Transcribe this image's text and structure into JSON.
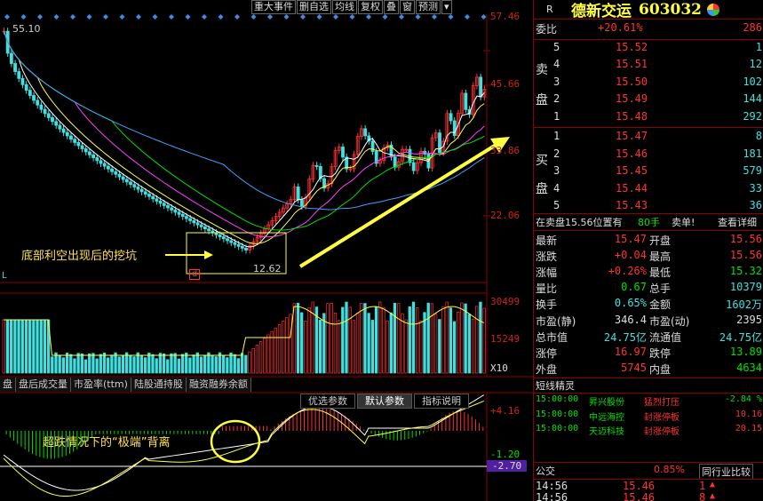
{
  "toolbar": [
    "重大事件",
    "删自选",
    "均线",
    "复权",
    "叠",
    "窗",
    "预测"
  ],
  "price_axis": {
    "p1": "57.46",
    "p2": "45.66",
    "p3": "33.86",
    "p4": "22.06"
  },
  "vol_axis": {
    "v1": "30499",
    "v2": "15249",
    "unit": "X10"
  },
  "ind_axis": {
    "a1": "+4.16",
    "a2": "-1.20",
    "a3": "-2.70"
  },
  "high_marker": "55.10",
  "low_marker": "12.62",
  "corner_l": "L",
  "tabs": [
    "盘",
    "盘后成交量",
    "市盈率(ttm)",
    "陆股通持股",
    "融资融券余额"
  ],
  "param_tabs": [
    "优选参数",
    "默认参数",
    "指标说明"
  ],
  "annotations": {
    "pit": "底部利空出现后的挖坑",
    "divergence": "超跌情况下的“极端”背离"
  },
  "badge": "d",
  "stock": {
    "r": "R",
    "name": "德新交运",
    "code": "603032"
  },
  "wei": {
    "label": "委比",
    "pct": "+20.61%",
    "diff": "286"
  },
  "sell_label": [
    "卖",
    "盘"
  ],
  "buy_label": [
    "买",
    "盘"
  ],
  "sells": [
    {
      "lvl": "5",
      "price": "15.52",
      "vol": "1"
    },
    {
      "lvl": "4",
      "price": "15.51",
      "vol": "12"
    },
    {
      "lvl": "3",
      "price": "15.50",
      "vol": "102"
    },
    {
      "lvl": "2",
      "price": "15.49",
      "vol": "144"
    },
    {
      "lvl": "1",
      "price": "15.48",
      "vol": "292"
    }
  ],
  "buys": [
    {
      "lvl": "1",
      "price": "15.47",
      "vol": "8"
    },
    {
      "lvl": "2",
      "price": "15.46",
      "vol": "181"
    },
    {
      "lvl": "3",
      "price": "15.45",
      "vol": "579"
    },
    {
      "lvl": "4",
      "price": "15.44",
      "vol": "33"
    },
    {
      "lvl": "5",
      "price": "15.43",
      "vol": "36"
    }
  ],
  "inline_bar": {
    "text": "在卖盘15.56位置有",
    "num": "80手",
    "action": "卖单!",
    "detail": "查看详细"
  },
  "quote": [
    {
      "l": "最新",
      "lv": "15.47",
      "lc": "red",
      "r": "开盘",
      "rv": "15.56",
      "rc": "red"
    },
    {
      "l": "涨跌",
      "lv": "+0.04",
      "lc": "red",
      "r": "最高",
      "rv": "15.56",
      "rc": "red"
    },
    {
      "l": "涨幅",
      "lv": "+0.26%",
      "lc": "red",
      "r": "最低",
      "rv": "15.32",
      "rc": "green"
    },
    {
      "l": "量比",
      "lv": "0.67",
      "lc": "green",
      "r": "总手",
      "rv": "10379",
      "rc": "cyan"
    },
    {
      "l": "换手",
      "lv": "0.65%",
      "lc": "cyan",
      "r": "金额",
      "rv": "1602万",
      "rc": "cyan"
    },
    {
      "l": "市盈(静)",
      "lv": "346.4",
      "lc": "white",
      "r": "市盈(动)",
      "rv": "2395",
      "rc": "white"
    },
    {
      "l": "总市值",
      "lv": "24.75亿",
      "lc": "cyan",
      "r": "流通值",
      "rv": "24.75亿",
      "rc": "cyan"
    },
    {
      "l": "涨停",
      "lv": "16.97",
      "lc": "red",
      "r": "跌停",
      "rv": "13.89",
      "rc": "green"
    },
    {
      "l": "外盘",
      "lv": "5745",
      "lc": "red",
      "r": "内盘",
      "rv": "4634",
      "rc": "green"
    }
  ],
  "short_title": "短线精灵",
  "short": [
    {
      "time": "15:00:00",
      "name": "昇兴股份",
      "event": "猛烈打压",
      "val": "-2.84 %",
      "vc": "green"
    },
    {
      "time": "15:00:00",
      "name": "中远海控",
      "event": "封涨停板",
      "val": "10.16",
      "vc": "red"
    },
    {
      "time": "15:00:00",
      "name": "天迈科技",
      "event": "封涨停板",
      "val": "20.15",
      "vc": "red"
    }
  ],
  "gongjiao": {
    "label": "公交",
    "pct": "0.85%",
    "compare": "同行业比较"
  },
  "ticks": [
    {
      "time": "14:56",
      "price": "15.46",
      "vol": "1"
    },
    {
      "time": "14:56",
      "price": "15.46",
      "vol": "8"
    }
  ]
}
